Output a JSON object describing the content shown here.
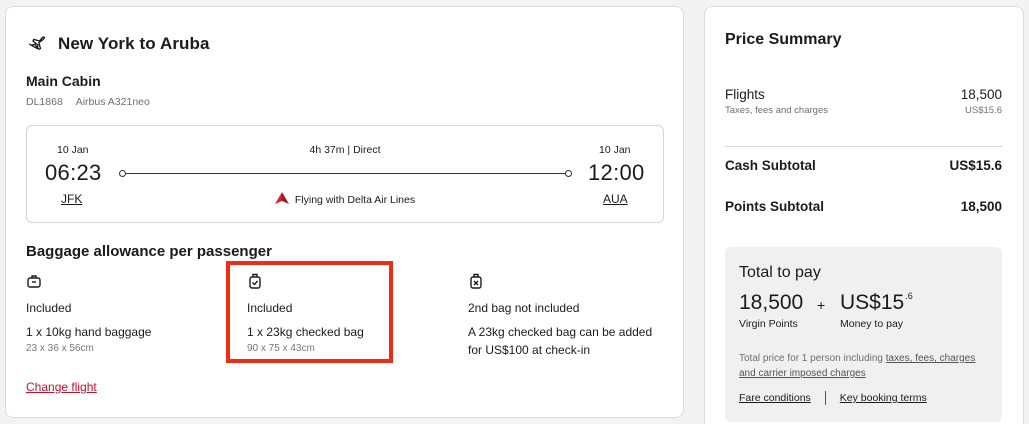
{
  "flight": {
    "title": "New York to Aruba",
    "cabin": "Main Cabin",
    "flight_number": "DL1868",
    "aircraft": "Airbus A321neo",
    "departure": {
      "date": "10 Jan",
      "time": "06:23",
      "airport": "JFK"
    },
    "arrival": {
      "date": "10 Jan",
      "time": "12:00",
      "airport": "AUA"
    },
    "duration": "4h 37m  |  Direct",
    "carrier": "Flying with Delta Air Lines"
  },
  "baggage": {
    "heading": "Baggage allowance per passenger",
    "items": [
      {
        "icon": "hand-bag-icon",
        "status": "Included",
        "detail": "1 x 10kg hand baggage",
        "dims": "23 x 36 x 56cm"
      },
      {
        "icon": "checked-bag-icon",
        "status": "Included",
        "detail": "1 x 23kg checked bag",
        "dims": "90 x 75 x 43cm"
      },
      {
        "icon": "bag-not-included-icon",
        "status": "2nd bag not included",
        "detail": "A 23kg checked bag can be added for US$100 at check-in",
        "dims": ""
      }
    ]
  },
  "change_flight": "Change flight",
  "summary": {
    "title": "Price Summary",
    "flights_label": "Flights",
    "flights_value": "18,500",
    "taxes_label": "Taxes, fees and charges",
    "taxes_value": "US$15.6",
    "cash_subtotal_label": "Cash Subtotal",
    "cash_subtotal_value": "US$15.6",
    "points_subtotal_label": "Points Subtotal",
    "points_subtotal_value": "18,500"
  },
  "total": {
    "label": "Total to pay",
    "points": "18,500",
    "plus": "+",
    "cash_main": "US$15",
    "cash_fraction": ".6",
    "points_label": "Virgin Points",
    "cash_label": "Money to pay",
    "note_prefix": "Total price for 1 person including ",
    "note_link": "taxes, fees, charges and carrier imposed charges",
    "fare_conditions": "Fare conditions",
    "booking_terms": "Key booking terms"
  },
  "colors": {
    "accent": "#c4122e",
    "highlight": "#ee2e12",
    "delta_red": "#d8232a"
  }
}
